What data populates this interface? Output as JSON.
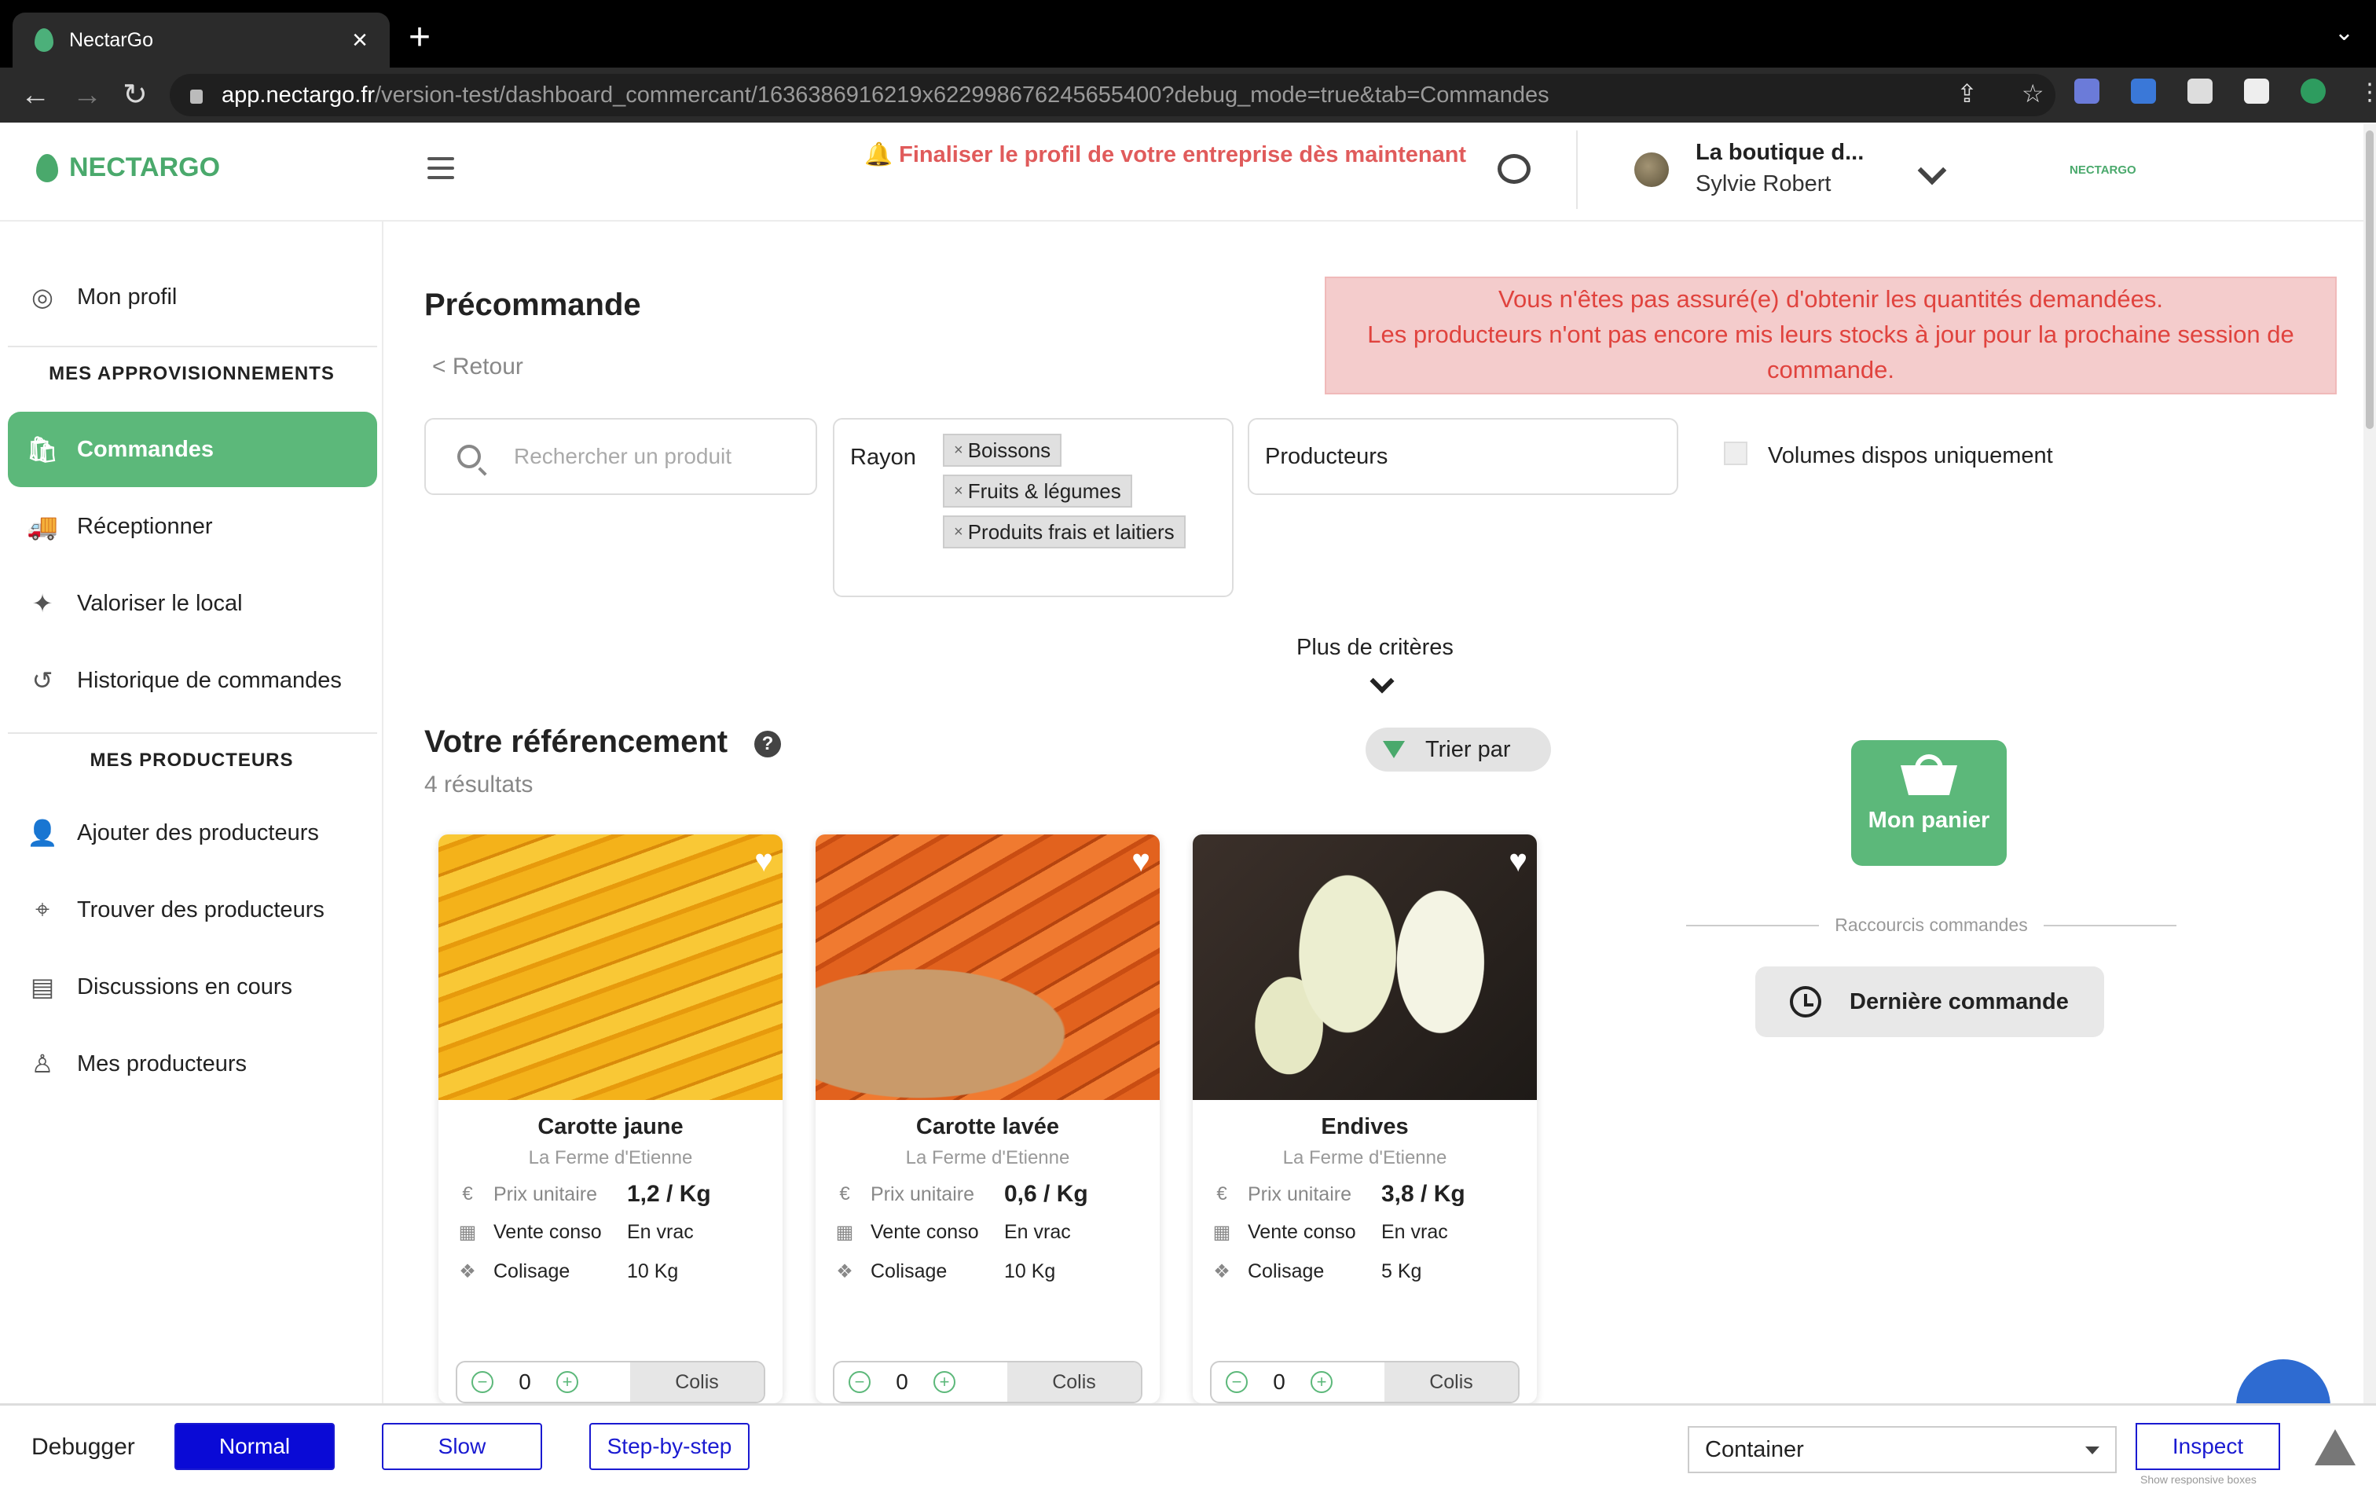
{
  "browser": {
    "tab_title": "NectarGo",
    "url_host": "app.nectargo.fr",
    "url_path": "/version-test/dashboard_commercant/1636386916219x622998676245655400?debug_mode=true&tab=Commandes"
  },
  "header": {
    "logo_text": "NECTARGO",
    "alert": "Finaliser le profil de votre entreprise dès maintenant",
    "business_name": "La boutique d...",
    "user_name": "Sylvie Robert",
    "logo_small": "NECTARGO"
  },
  "sidebar": {
    "profile": "Mon profil",
    "section1": "MES APPROVISIONNEMENTS",
    "items1": [
      {
        "label": "Commandes"
      },
      {
        "label": "Réceptionner"
      },
      {
        "label": "Valoriser le local"
      },
      {
        "label": "Historique de commandes"
      }
    ],
    "section2": "MES PRODUCTEURS",
    "items2": [
      {
        "label": "Ajouter des producteurs"
      },
      {
        "label": "Trouver des producteurs"
      },
      {
        "label": "Discussions en cours"
      },
      {
        "label": "Mes producteurs"
      }
    ]
  },
  "main": {
    "title": "Précommande",
    "back": "< Retour",
    "warning_line1": "Vous n'êtes pas assuré(e) d'obtenir les quantités demandées.",
    "warning_line2": "Les producteurs n'ont pas encore mis leurs stocks à jour pour la prochaine session de commande.",
    "search_placeholder": "Rechercher un produit",
    "rayon_label": "Rayon",
    "rayon_chips": [
      "Boissons",
      "Fruits & légumes",
      "Produits frais et laitiers"
    ],
    "producteurs_label": "Producteurs",
    "volumes_label": "Volumes dispos uniquement",
    "more_criteria": "Plus de critères",
    "ref_title": "Votre référencement",
    "results_count": "4 résultats",
    "sort_label": "Trier par",
    "basket_label": "Mon panier",
    "shortcuts_label": "Raccourcis commandes",
    "last_order_label": "Dernière commande"
  },
  "products": [
    {
      "name": "Carotte jaune",
      "farm": "La Ferme d'Etienne",
      "price_label": "Prix unitaire",
      "price": "1,2 / Kg",
      "sale_label": "Vente conso",
      "sale": "En vrac",
      "pack_label": "Colisage",
      "pack": "10 Kg",
      "qty": "0",
      "unit": "Colis"
    },
    {
      "name": "Carotte lavée",
      "farm": "La Ferme d'Etienne",
      "price_label": "Prix unitaire",
      "price": "0,6 / Kg",
      "sale_label": "Vente conso",
      "sale": "En vrac",
      "pack_label": "Colisage",
      "pack": "10 Kg",
      "qty": "0",
      "unit": "Colis"
    },
    {
      "name": "Endives",
      "farm": "La Ferme d'Etienne",
      "price_label": "Prix unitaire",
      "price": "3,8 / Kg",
      "sale_label": "Vente conso",
      "sale": "En vrac",
      "pack_label": "Colisage",
      "pack": "5 Kg",
      "qty": "0",
      "unit": "Colis"
    }
  ],
  "debugger": {
    "label": "Debugger",
    "normal": "Normal",
    "slow": "Slow",
    "step": "Step-by-step",
    "select_value": "Container",
    "inspect": "Inspect",
    "responsive": "Show responsive boxes"
  },
  "colors": {
    "brand_green": "#5cb87a",
    "alert_red": "#e05b5b",
    "warning_bg": "#f4cccc"
  }
}
